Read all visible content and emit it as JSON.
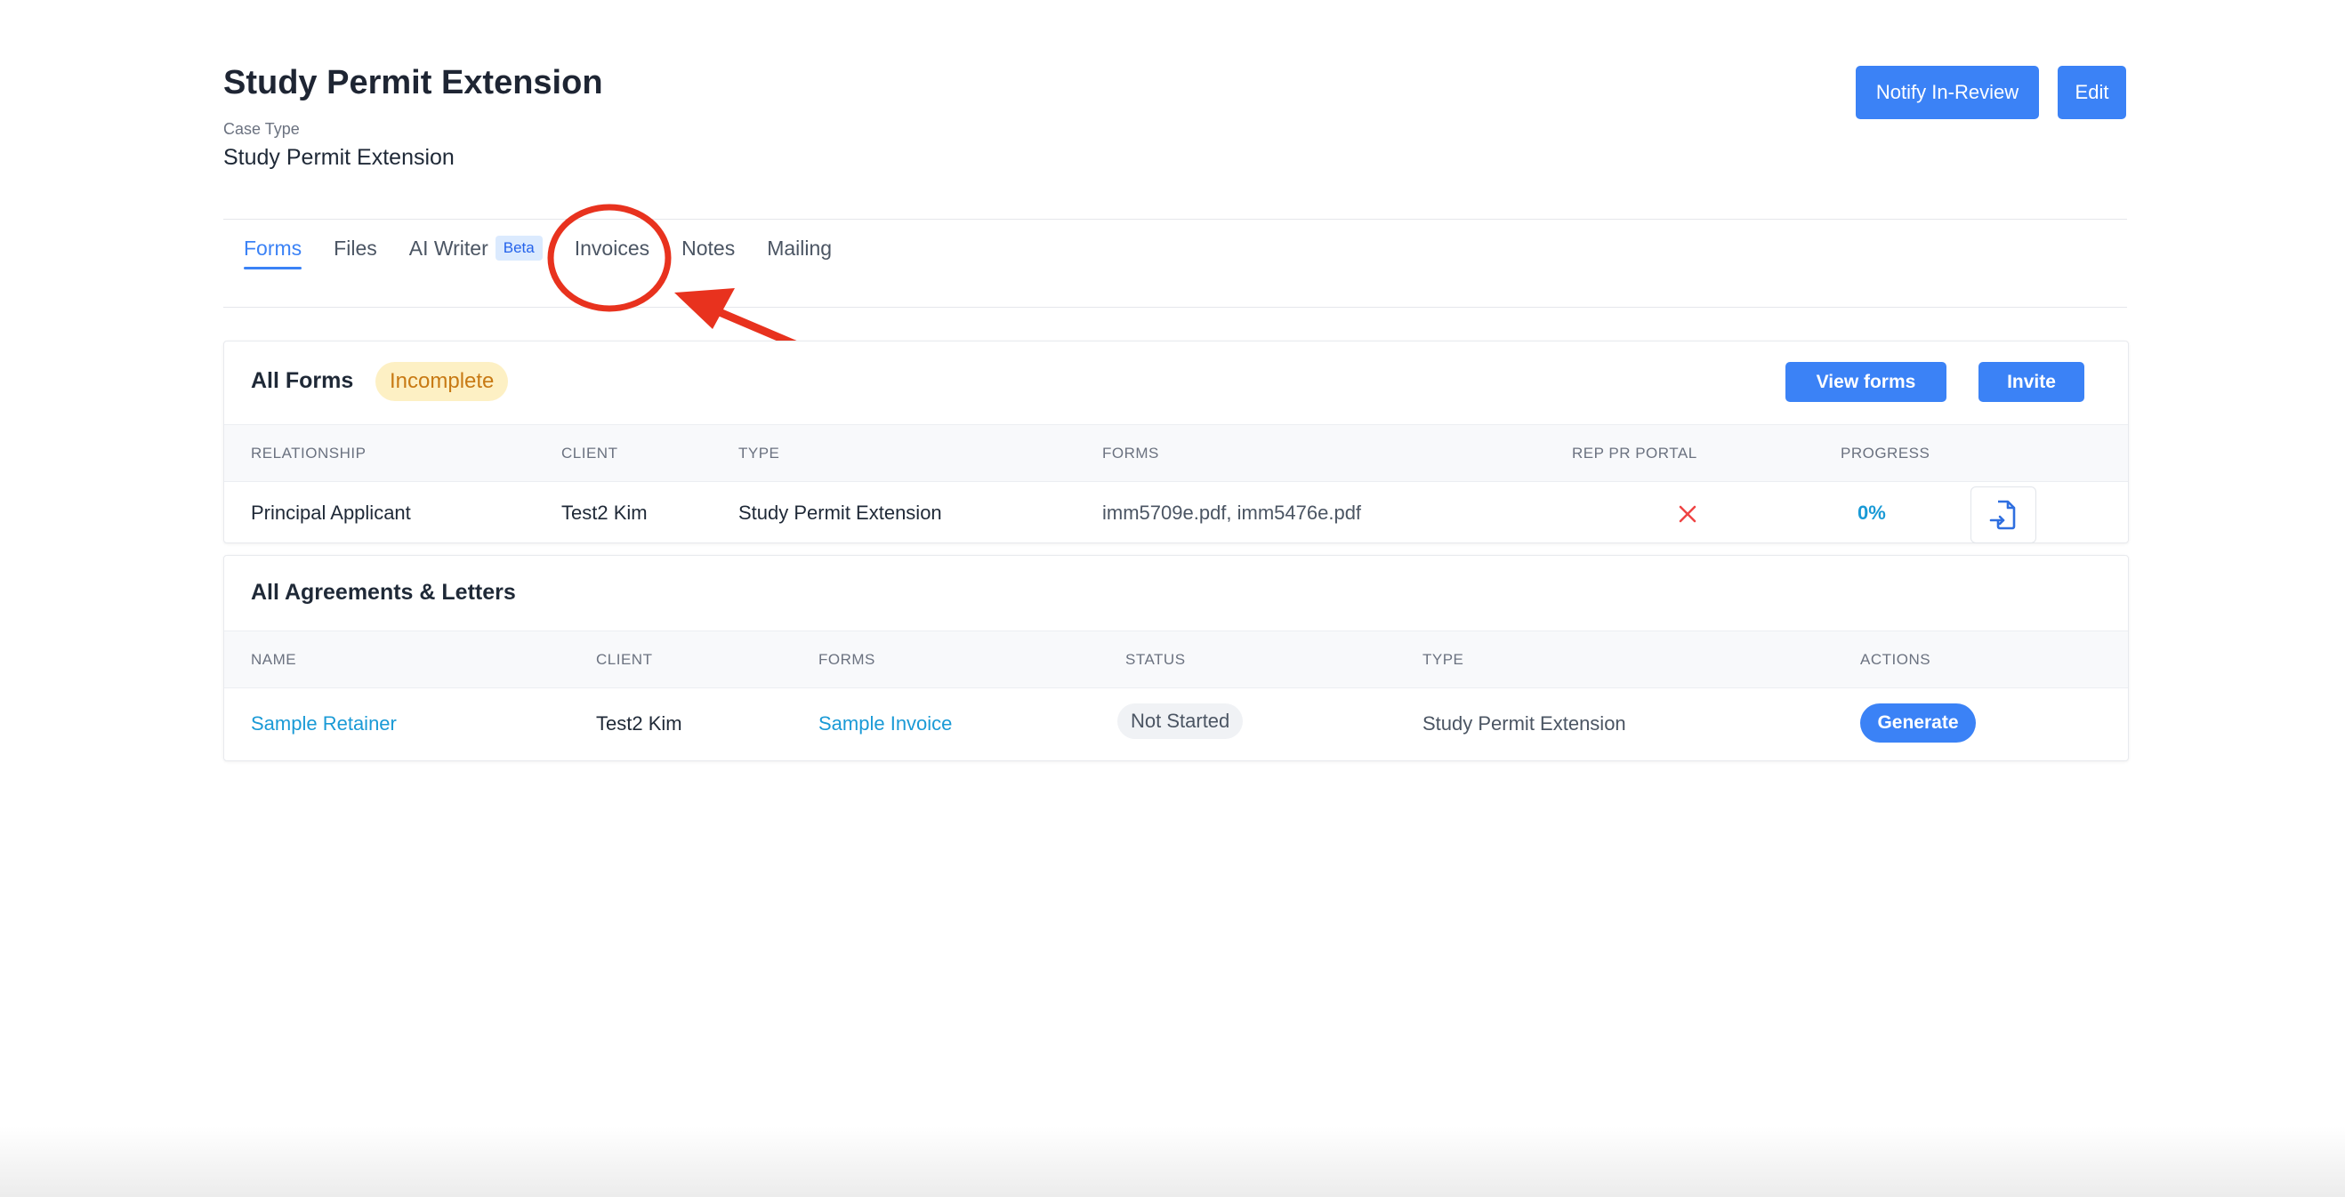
{
  "header": {
    "title": "Study Permit Extension",
    "case_type_label": "Case Type",
    "case_type_value": "Study Permit Extension",
    "notify_label": "Notify In-Review",
    "edit_label": "Edit"
  },
  "tabs": [
    {
      "label": "Forms",
      "active": true
    },
    {
      "label": "Files"
    },
    {
      "label": "AI Writer",
      "badge": "Beta"
    },
    {
      "label": "Invoices",
      "highlighted": true
    },
    {
      "label": "Notes"
    },
    {
      "label": "Mailing"
    }
  ],
  "annotation": {
    "color": "#e8321e",
    "shape": "red circle around Invoices tab with arrow"
  },
  "forms_card": {
    "title": "All Forms",
    "status_badge": "Incomplete",
    "view_forms_label": "View forms",
    "invite_label": "Invite",
    "columns": [
      "RELATIONSHIP",
      "CLIENT",
      "TYPE",
      "FORMS",
      "REP PR PORTAL",
      "PROGRESS"
    ],
    "rows": [
      {
        "relationship": "Principal Applicant",
        "client": "Test2 Kim",
        "type": "Study Permit Extension",
        "forms": "imm5709e.pdf, imm5476e.pdf",
        "rep_pr_portal_icon": "x-icon",
        "progress": "0%",
        "action_icon": "file-import-icon"
      }
    ]
  },
  "agreements_card": {
    "title": "All Agreements & Letters",
    "columns": [
      "NAME",
      "CLIENT",
      "FORMS",
      "STATUS",
      "TYPE",
      "ACTIONS"
    ],
    "rows": [
      {
        "name": "Sample Retainer",
        "client": "Test2 Kim",
        "forms": "Sample Invoice",
        "status": "Not Started",
        "type": "Study Permit Extension",
        "action_label": "Generate"
      }
    ]
  },
  "colors": {
    "accent": "#3b82f6",
    "link": "#1a9ad6",
    "warning_bg": "#fdf0c4",
    "warning_text": "#c87a14",
    "danger": "#e8321e"
  }
}
